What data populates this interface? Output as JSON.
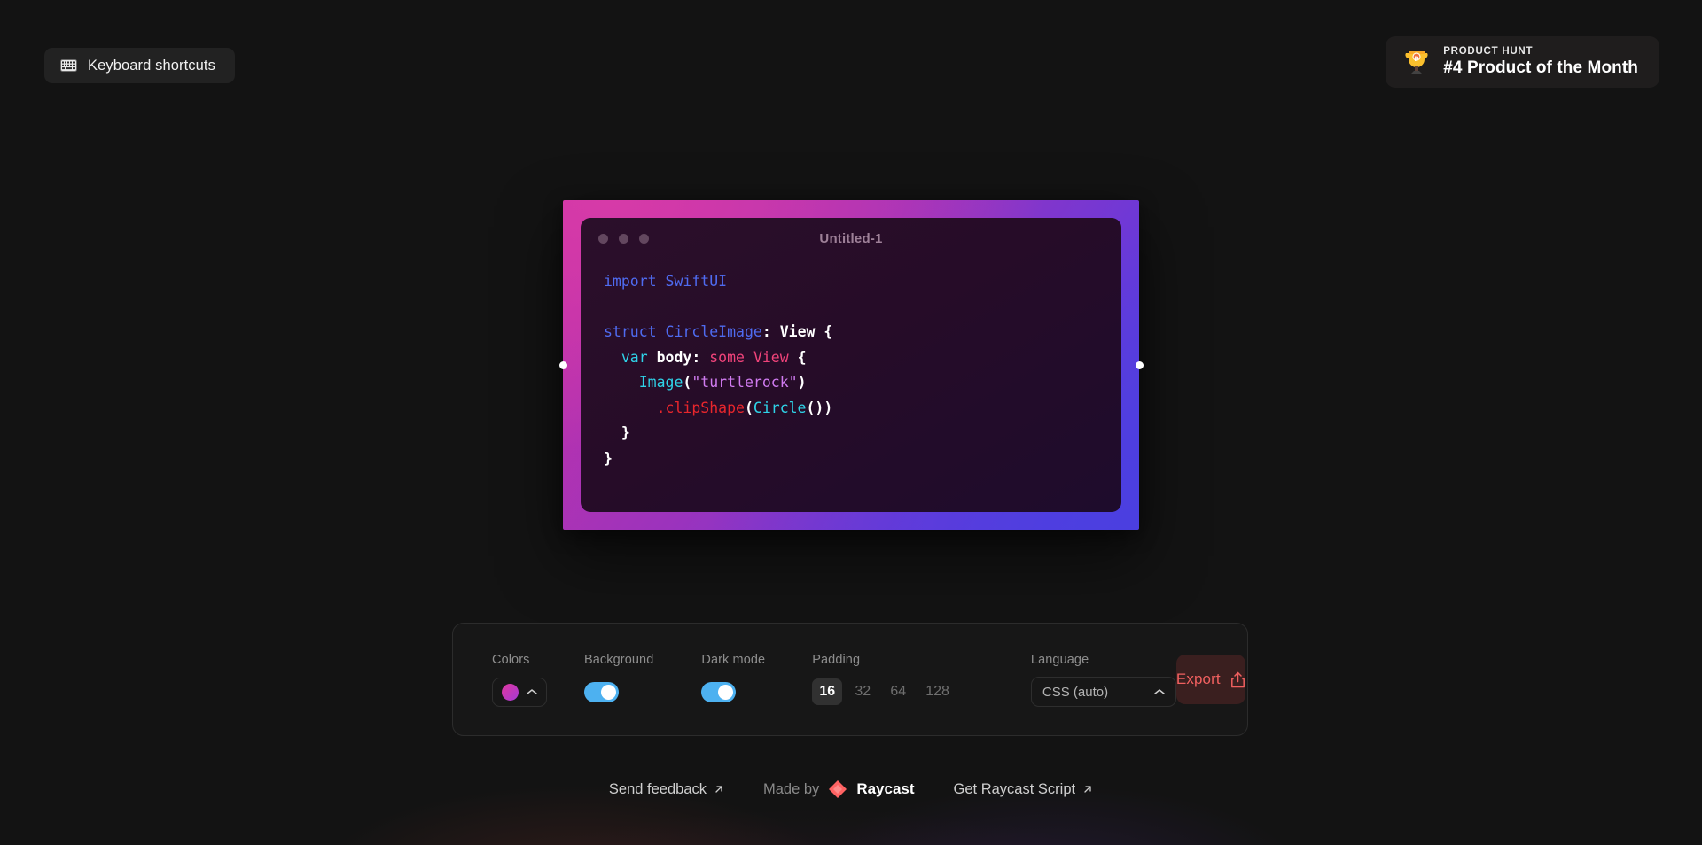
{
  "header": {
    "keyboard_shortcuts": {
      "label": "Keyboard shortcuts",
      "icon": "keyboard-icon"
    },
    "product_hunt": {
      "kicker": "PRODUCT HUNT",
      "title": "#4 Product of the Month",
      "icon": "trophy-icon"
    }
  },
  "editor": {
    "title": "Untitled-1",
    "traffic_lights": [
      "close-dot",
      "minimize-dot",
      "maximize-dot"
    ],
    "code_lines": [
      [
        {
          "t": "import",
          "c": "kw"
        },
        {
          "t": " ",
          "c": "white"
        },
        {
          "t": "SwiftUI",
          "c": "type-blu"
        }
      ],
      [],
      [
        {
          "t": "struct",
          "c": "kw"
        },
        {
          "t": " ",
          "c": "white"
        },
        {
          "t": "CircleImage",
          "c": "type-blu"
        },
        {
          "t": ":",
          "c": "plain"
        },
        {
          "t": " ",
          "c": "white"
        },
        {
          "t": "View",
          "c": "plain"
        },
        {
          "t": " ",
          "c": "white"
        },
        {
          "t": "{",
          "c": "plain"
        }
      ],
      [
        {
          "t": "  ",
          "c": "white"
        },
        {
          "t": "var",
          "c": "cyan"
        },
        {
          "t": " ",
          "c": "white"
        },
        {
          "t": "body",
          "c": "plain"
        },
        {
          "t": ":",
          "c": "plain"
        },
        {
          "t": " ",
          "c": "white"
        },
        {
          "t": "some",
          "c": "pink"
        },
        {
          "t": " ",
          "c": "white"
        },
        {
          "t": "View",
          "c": "pink"
        },
        {
          "t": " ",
          "c": "white"
        },
        {
          "t": "{",
          "c": "plain"
        }
      ],
      [
        {
          "t": "    ",
          "c": "white"
        },
        {
          "t": "Image",
          "c": "cyan"
        },
        {
          "t": "(",
          "c": "plain"
        },
        {
          "t": "\"turtlerock\"",
          "c": "violet"
        },
        {
          "t": ")",
          "c": "plain"
        }
      ],
      [
        {
          "t": "      ",
          "c": "white"
        },
        {
          "t": ".clipShape",
          "c": "red"
        },
        {
          "t": "(",
          "c": "plain"
        },
        {
          "t": "Circle",
          "c": "cyan"
        },
        {
          "t": "())",
          "c": "plain"
        }
      ],
      [
        {
          "t": "  ",
          "c": "white"
        },
        {
          "t": "}",
          "c": "plain"
        }
      ],
      [
        {
          "t": "}",
          "c": "plain"
        }
      ]
    ],
    "gradient": {
      "from": "#c832a6",
      "mid": "#9b33bd",
      "to": "#4b3fe4"
    },
    "background_color": "#2b0f2a"
  },
  "controls": {
    "colors": {
      "label": "Colors",
      "swatch_from": "#e0379f",
      "swatch_to": "#a43ad4",
      "chevron": "chevron-up-icon"
    },
    "background": {
      "label": "Background",
      "enabled": true,
      "accent": "#4db1f0"
    },
    "dark_mode": {
      "label": "Dark mode",
      "enabled": true,
      "accent": "#4db1f0"
    },
    "padding": {
      "label": "Padding",
      "options": [
        "16",
        "32",
        "64",
        "128"
      ],
      "selected": "16"
    },
    "language": {
      "label": "Language",
      "selected": "CSS (auto)",
      "chevron": "chevron-up-icon"
    },
    "export": {
      "label": "Export",
      "icon": "share-upload-icon",
      "color": "#f0605f",
      "background": "#3a1f1f"
    }
  },
  "footer": {
    "send_feedback": "Send feedback",
    "made_by": "Made by",
    "brand": "Raycast",
    "get_script": "Get Raycast Script",
    "external_icon": "arrow-up-right-icon"
  }
}
